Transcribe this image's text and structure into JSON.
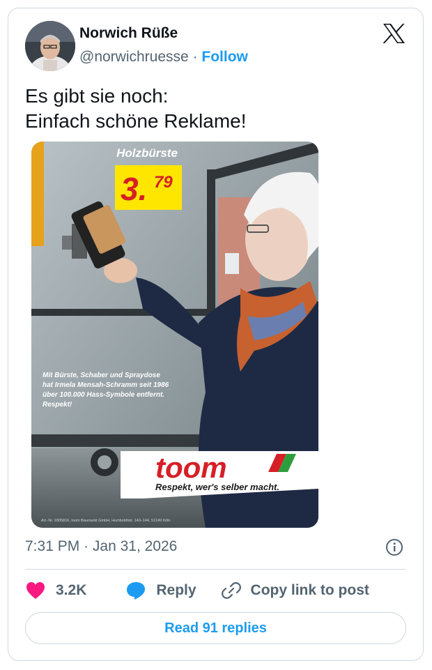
{
  "author": {
    "name": "Norwich Rüße",
    "handle": "@norwichruesse",
    "separator": "·",
    "follow_label": "Follow"
  },
  "tweet": {
    "line1": "Es gibt sie noch:",
    "line2": "Einfach schöne Reklame!"
  },
  "ad": {
    "product": "Holzbürste",
    "price_main": "3.",
    "price_cents": "79",
    "caption_lines": [
      "Mit Bürste, Schaber und Spraydose",
      "hat Irmela Mensah-Schramm seit 1986",
      "über 100.000 Hass-Symbole entfernt.",
      "Respekt!"
    ],
    "brand": "toom",
    "slogan": "Respekt, wer's selber macht.",
    "fine_print": "Art.-Nr. 9305816, toom Baumarkt GmbH, Humboldtstr. 140–144, 51149 Köln"
  },
  "meta": {
    "time": "7:31 PM",
    "separator": "·",
    "date": "Jan 31, 2026"
  },
  "actions": {
    "likes": "3.2K",
    "reply_label": "Reply",
    "copy_label": "Copy link to post"
  },
  "read_replies_label": "Read 91 replies",
  "colors": {
    "link": "#1d9bf0",
    "heart": "#f91880",
    "secondary_text": "#536471",
    "price_yellow": "#ffe600",
    "brand_red": "#d61f26"
  },
  "icons": [
    "x-logo-icon",
    "info-icon",
    "heart-icon",
    "reply-icon",
    "link-icon"
  ]
}
